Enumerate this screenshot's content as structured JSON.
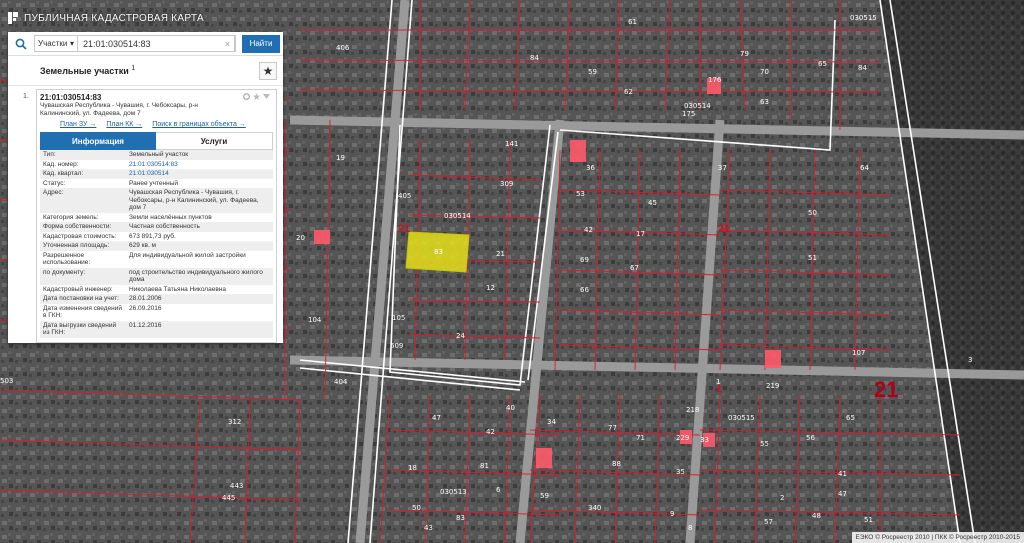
{
  "app": {
    "title": "ПУБЛИЧНАЯ КАДАСТРОВАЯ КАРТА"
  },
  "search": {
    "type_value": "Участки",
    "query": "21:01:030514:83",
    "find_label": "Найти",
    "clear_label": "×"
  },
  "results": {
    "title": "Земельные участки",
    "count": "1",
    "item": {
      "index": "1.",
      "number": "21:01:030514:83",
      "address": "Чувашская Республика - Чувашия, г. Чебоксары, р-н Калининский, ул. Фадеева, дом 7",
      "links": [
        "План ЗУ →",
        "План КК →",
        "Поиск в границах объекта →"
      ]
    }
  },
  "tabs": {
    "info": "Информация",
    "services": "Услуги"
  },
  "attributes": [
    {
      "k": "Тип:",
      "v": "Земельный участок"
    },
    {
      "k": "Кад. номер:",
      "v": "21:01:030514:83",
      "link": true
    },
    {
      "k": "Кад. квартал:",
      "v": "21:01:030514",
      "link": true
    },
    {
      "k": "Статус:",
      "v": "Ранее учтенный"
    },
    {
      "k": "Адрес:",
      "v": "Чувашская Республика - Чувашия, г. Чебоксары, р-н Калининский, ул. Фадеева, дом 7"
    },
    {
      "k": "Категория земель:",
      "v": "Земли населённых пунктов"
    },
    {
      "k": "Форма собственности:",
      "v": "Частная собственность"
    },
    {
      "k": "Кадастровая стоимость:",
      "v": "673 891,73 руб."
    },
    {
      "k": "Уточненная площадь:",
      "v": "629 кв. м"
    },
    {
      "k": "Разрешенное использование:",
      "v": "Для индивидуальной жилой застройки"
    },
    {
      "k": "по документу:",
      "v": "под строительство индивидуального жилого дома"
    },
    {
      "k": "Кадастровый инженер:",
      "v": "Николаева Татьяна Николаевна"
    },
    {
      "k": "Дата постановки на учет:",
      "v": "28.01.2006"
    },
    {
      "k": "Дата изменения сведений в ГКН:",
      "v": "26.09.2016"
    },
    {
      "k": "Дата выгрузки сведений из ГКН:",
      "v": "01.12.2016"
    }
  ],
  "map": {
    "labels": [
      "030514",
      "030514",
      "030515",
      "030515",
      "030513",
      "21",
      "21",
      "21",
      "1",
      "3",
      "404",
      "503"
    ],
    "parcel_numbers": [
      "406",
      "61",
      "79",
      "70",
      "65",
      "63",
      "62",
      "59",
      "176",
      "175",
      "84",
      "84",
      "17",
      "69",
      "67",
      "66",
      "42",
      "53",
      "45",
      "36",
      "37",
      "50",
      "64",
      "51",
      "141",
      "309",
      "405",
      "19",
      "20",
      "21",
      "24",
      "105",
      "609",
      "104",
      "107",
      "219",
      "218",
      "229",
      "33",
      "34",
      "59",
      "340",
      "312",
      "443",
      "445",
      "88",
      "77",
      "71",
      "1",
      "55",
      "56",
      "47",
      "41",
      "65",
      "51",
      "48",
      "57",
      "2",
      "35",
      "9",
      "8",
      "6",
      "81",
      "83",
      "50",
      "43",
      "42",
      "40",
      "47",
      "18",
      "12"
    ],
    "highlight_number": "83",
    "colors": {
      "selected_fill": "#e6e01a",
      "parcel_stroke": "#dd1a2a",
      "building": "#ff5a6a",
      "block_border": "#ffffff"
    }
  },
  "attribution": "ЕЭКО © Росреестр 2010 | ПКК © Росреестр 2010-2015"
}
